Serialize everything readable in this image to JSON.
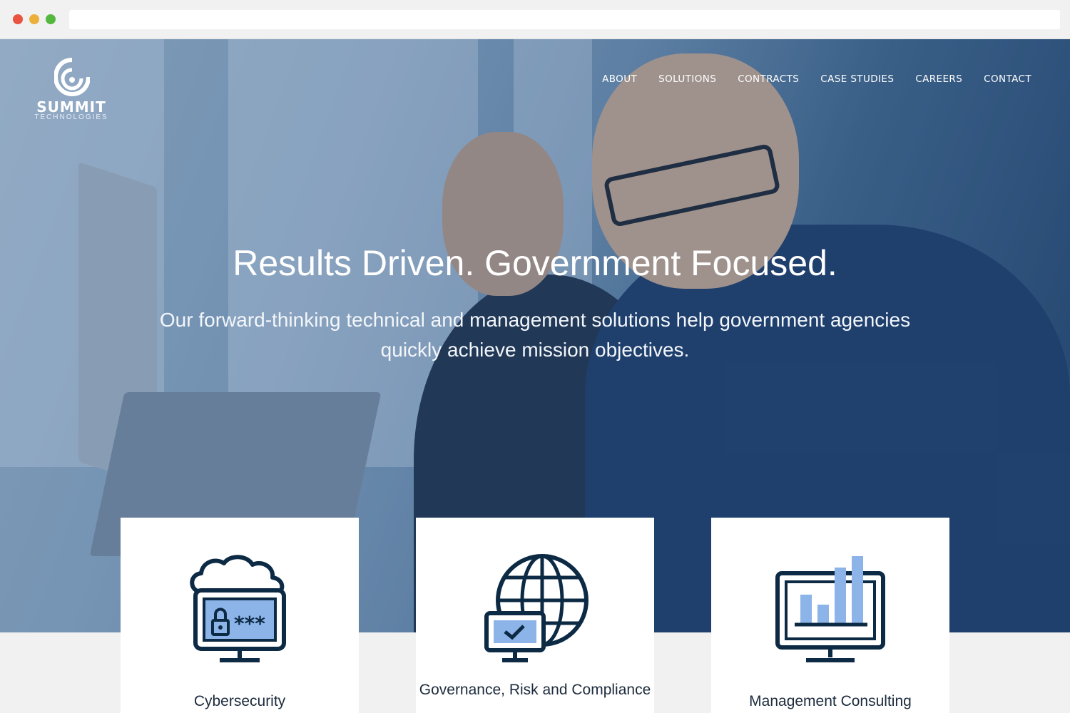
{
  "brand": {
    "name": "SUMMIT",
    "tagline": "TECHNOLOGIES"
  },
  "nav": {
    "items": [
      {
        "label": "ABOUT"
      },
      {
        "label": "SOLUTIONS"
      },
      {
        "label": "CONTRACTS"
      },
      {
        "label": "CASE STUDIES"
      },
      {
        "label": "CAREERS"
      },
      {
        "label": "CONTACT"
      }
    ]
  },
  "hero": {
    "headline": "Results Driven. Government Focused.",
    "subheadline": "Our forward-thinking technical and management solutions help government agencies quickly achieve mission objectives."
  },
  "cards": [
    {
      "label": "Cybersecurity",
      "icon": "cloud-lock-monitor-icon"
    },
    {
      "label": "Governance, Risk and Compliance",
      "icon": "globe-checkmark-monitor-icon"
    },
    {
      "label": "Management Consulting",
      "icon": "bar-chart-monitor-icon"
    }
  ],
  "colors": {
    "icon_stroke": "#0d2a45",
    "icon_fill": "#8cb4e8",
    "card_text": "#1c2b3d"
  }
}
